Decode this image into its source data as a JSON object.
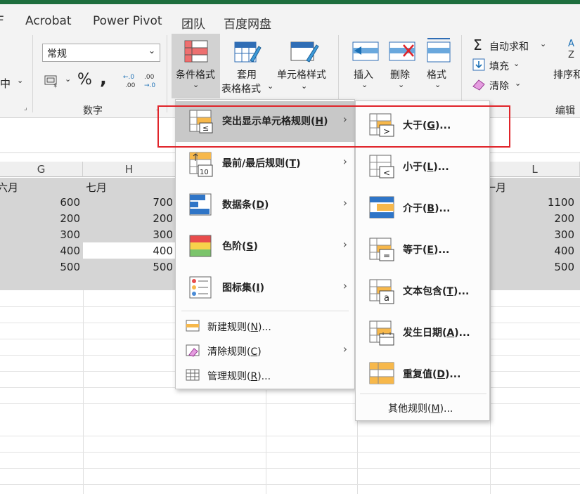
{
  "tabs": [
    "Acrobat",
    "Power Pivot",
    "团队",
    "百度网盘"
  ],
  "tab_partial_left": "F",
  "ribbon": {
    "number_format": "常规",
    "left_partial": "中",
    "number_group_label": "数字",
    "cond_format": "条件格式",
    "table_format_line1": "套用",
    "table_format_line2": "表格格式",
    "cell_style": "单元格样式",
    "insert": "插入",
    "delete": "删除",
    "format": "格式",
    "autosum": "自动求和",
    "fill": "填充",
    "clear": "清除",
    "sort_partial": "排序和",
    "edit_group_label": "编辑",
    "percent": "%",
    "comma": ","
  },
  "sheet": {
    "col_g": "G",
    "col_h": "H",
    "col_l": "L",
    "hdr_g": "六月",
    "hdr_h": "七月",
    "hdr_l": "一月",
    "g_values": [
      "600",
      "200",
      "300",
      "400",
      "500"
    ],
    "h_values": [
      "700",
      "200",
      "300",
      "400",
      "500"
    ],
    "l_values": [
      "1100",
      "200",
      "300",
      "400",
      "500"
    ]
  },
  "menu1": {
    "items": [
      {
        "label": "突出显示单元格规则(",
        "key": "H",
        "suffix": ")"
      },
      {
        "label": "最前/最后规则(",
        "key": "T",
        "suffix": ")"
      },
      {
        "label": "数据条(",
        "key": "D",
        "suffix": ")"
      },
      {
        "label": "色阶(",
        "key": "S",
        "suffix": ")"
      },
      {
        "label": "图标集(",
        "key": "I",
        "suffix": ")"
      }
    ],
    "small_items": [
      {
        "label": "新建规则(",
        "key": "N",
        "suffix": ")..."
      },
      {
        "label": "清除规则(",
        "key": "C",
        "suffix": ")"
      },
      {
        "label": "管理规则(",
        "key": "R",
        "suffix": ")..."
      }
    ]
  },
  "menu2": {
    "items": [
      {
        "label": "大于(",
        "key": "G",
        "suffix": ")..."
      },
      {
        "label": "小于(",
        "key": "L",
        "suffix": ")..."
      },
      {
        "label": "介于(",
        "key": "B",
        "suffix": ")..."
      },
      {
        "label": "等于(",
        "key": "E",
        "suffix": ")..."
      },
      {
        "label": "文本包含(",
        "key": "T",
        "suffix": ")..."
      },
      {
        "label": "发生日期(",
        "key": "A",
        "suffix": ")..."
      },
      {
        "label": "重复值(",
        "key": "D",
        "suffix": ")..."
      }
    ],
    "other": {
      "label": "其他规则(",
      "key": "M",
      "suffix": ")..."
    }
  },
  "icon_glyphs": {
    "gt": ">",
    "lt": "<",
    "eq": "=",
    "a": "a",
    "ten": "10",
    "le": "≤"
  }
}
